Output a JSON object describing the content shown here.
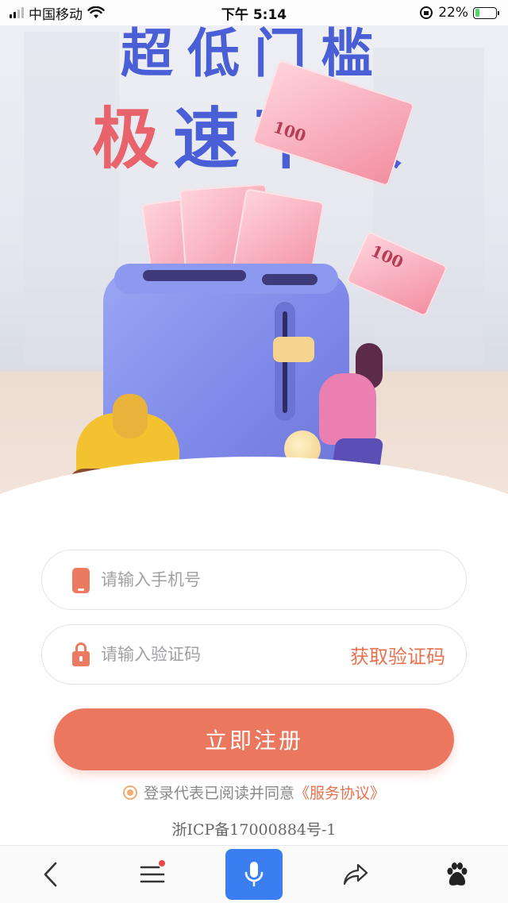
{
  "status_bar": {
    "carrier": "中国移动",
    "time": "下午 5:14",
    "battery_percent": "22%",
    "battery_level": 0.22
  },
  "hero": {
    "slogan_line1": "超低门槛",
    "slogan_line2_a": "极",
    "slogan_line2_b": "速下款",
    "bill_label": "100"
  },
  "form": {
    "phone_placeholder": "请输入手机号",
    "code_placeholder": "请输入验证码",
    "get_code_label": "获取验证码",
    "register_label": "立即注册",
    "agree_text": "登录代表已阅读并同意",
    "agree_link": "《服务协议》"
  },
  "footer": {
    "icp": "浙ICP备17000884号-1"
  },
  "browser_bar": {
    "items": [
      "back-icon",
      "menu-icon",
      "voice-icon",
      "share-icon",
      "baidu-paw-icon"
    ],
    "accent": "#3b7ef2"
  },
  "colors": {
    "brand": "#eb775e",
    "slogan_blue": "#4a5fd6",
    "slogan_red": "#e9636c"
  }
}
